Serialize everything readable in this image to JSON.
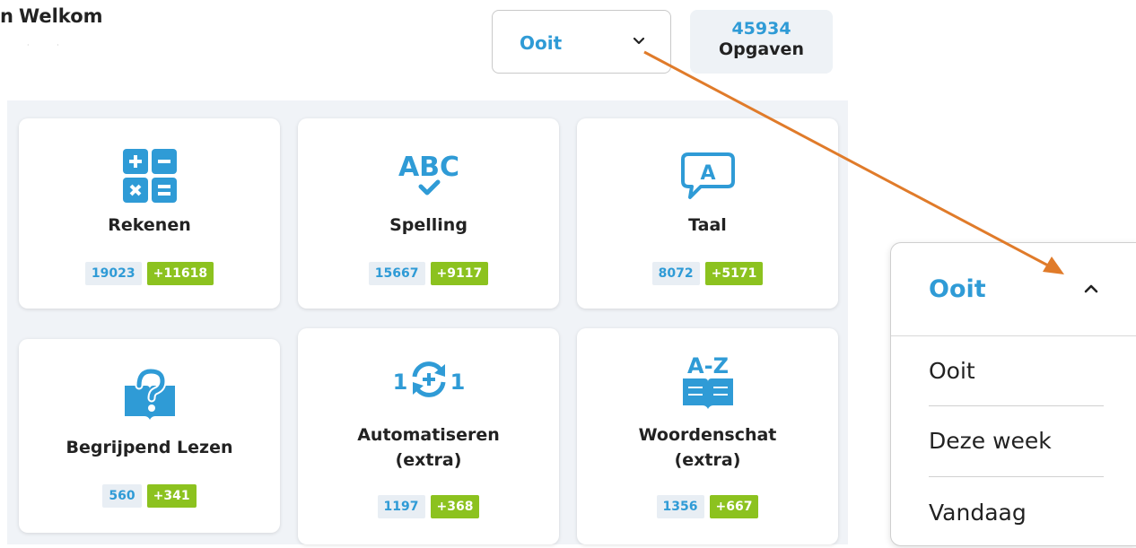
{
  "header": {
    "greeting": "Welkom",
    "period_selected": "Ooit",
    "exercise_count": "45934",
    "exercise_label": "Opgaven"
  },
  "subjects": [
    {
      "name": "Rekenen",
      "icon": "math-operations-icon",
      "total": "19023",
      "gain": "+11618"
    },
    {
      "name": "Spelling",
      "icon": "abc-check-icon",
      "total": "15667",
      "gain": "+9117"
    },
    {
      "name": "Taal",
      "icon": "speech-bubble-a-icon",
      "total": "8072",
      "gain": "+5171"
    },
    {
      "name": "Begrijpend Lezen",
      "icon": "book-question-icon",
      "total": "560",
      "gain": "+341"
    },
    {
      "name": "Automatiseren (extra)",
      "line1": "Automatiseren",
      "line2": "(extra)",
      "icon": "repeat-plus-icon",
      "total": "1197",
      "gain": "+368"
    },
    {
      "name": "Woordenschat (extra)",
      "line1": "Woordenschat",
      "line2": "(extra)",
      "icon": "book-az-icon",
      "total": "1356",
      "gain": "+667"
    }
  ],
  "dropdown": {
    "selected": "Ooit",
    "options": [
      "Ooit",
      "Deze week",
      "Vandaag"
    ]
  },
  "colors": {
    "accent_blue": "#2f9bd6",
    "gain_green": "#8cc21f",
    "arrow_orange": "#e07b2a",
    "panel_bg": "#f0f3f7"
  }
}
